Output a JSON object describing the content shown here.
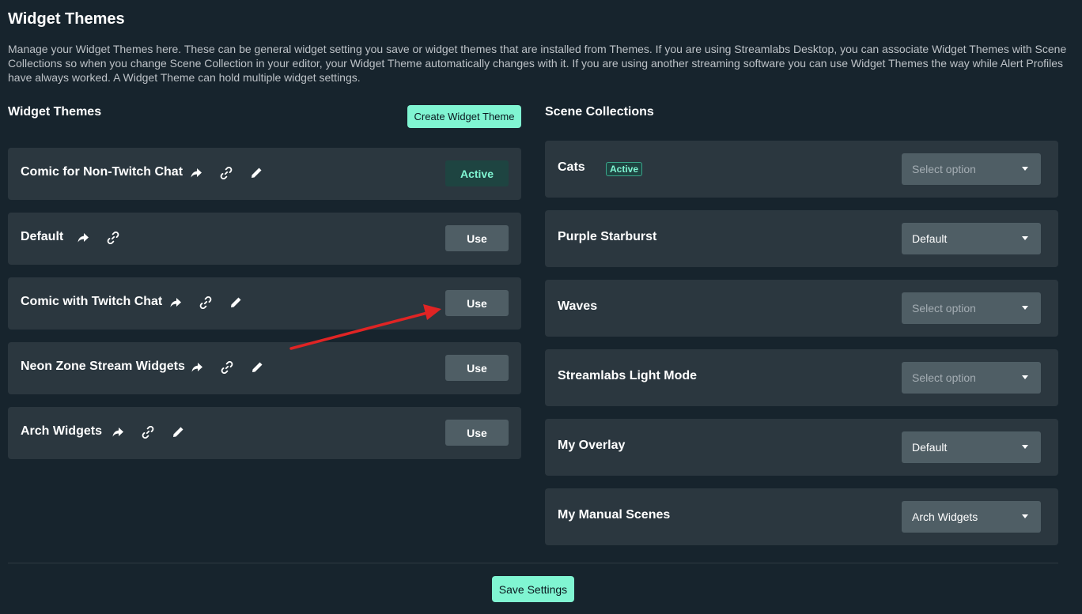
{
  "page": {
    "title": "Widget Themes",
    "description": "Manage your Widget Themes here. These can be general widget setting you save or widget themes that are installed from Themes. If you are using Streamlabs Desktop, you can associate Widget Themes with Scene Collections so when you change Scene Collection in your editor, your Widget Theme automatically changes with it. If you are using another streaming software you can use Widget Themes the way while Alert Profiles have always worked. A Widget Theme can hold multiple widget settings."
  },
  "themes_section": {
    "heading": "Widget Themes",
    "create_label": "Create Widget Theme",
    "items": [
      {
        "name": "Comic for Non-Twitch Chat",
        "action": "Active",
        "icons": [
          "share-icon",
          "link-icon",
          "edit-icon"
        ]
      },
      {
        "name": "Default",
        "action": "Use",
        "icons": [
          "share-icon",
          "link-icon"
        ]
      },
      {
        "name": "Comic with Twitch Chat",
        "action": "Use",
        "icons": [
          "share-icon",
          "link-icon",
          "edit-icon"
        ]
      },
      {
        "name": "Neon Zone Stream Widgets",
        "action": "Use",
        "icons": [
          "share-icon",
          "link-icon",
          "edit-icon"
        ]
      },
      {
        "name": "Arch Widgets",
        "action": "Use",
        "icons": [
          "share-icon",
          "link-icon",
          "edit-icon"
        ]
      }
    ]
  },
  "scenes_section": {
    "heading": "Scene Collections",
    "items": [
      {
        "name": "Cats",
        "badge": "Active",
        "selected": "Select option",
        "is_placeholder": true
      },
      {
        "name": "Purple Starburst",
        "selected": "Default",
        "is_placeholder": false
      },
      {
        "name": "Waves",
        "selected": "Select option",
        "is_placeholder": true
      },
      {
        "name": "Streamlabs Light Mode",
        "selected": "Select option",
        "is_placeholder": true
      },
      {
        "name": "My Overlay",
        "selected": "Default",
        "is_placeholder": false
      },
      {
        "name": "My Manual Scenes",
        "selected": "Arch Widgets",
        "is_placeholder": false
      }
    ]
  },
  "footer": {
    "save_label": "Save Settings"
  },
  "colors": {
    "background": "#17242d",
    "card": "#2b373f",
    "accent": "#80f5d2",
    "button_gray": "#4f5e65",
    "annotation_arrow": "#e02424"
  }
}
